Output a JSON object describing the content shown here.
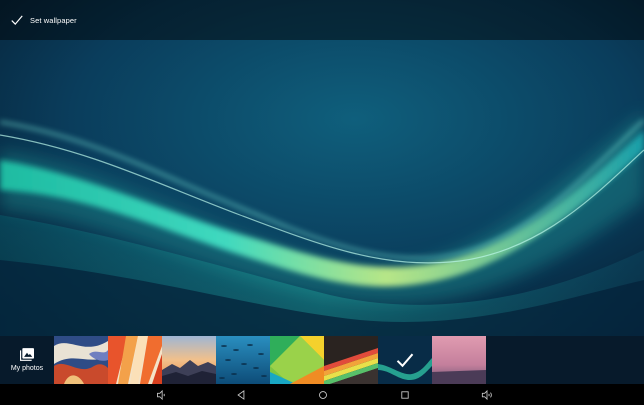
{
  "action_bar": {
    "set_wallpaper_label": "Set wallpaper",
    "icon": "check-icon"
  },
  "strip": {
    "my_photos_label": "My photos",
    "my_photos_icon": "photo-gallery-icon",
    "thumbnails": [
      {
        "name": "wallpaper-thumb-marble"
      },
      {
        "name": "wallpaper-thumb-orange-layers"
      },
      {
        "name": "wallpaper-thumb-sunset-mountains"
      },
      {
        "name": "wallpaper-thumb-fish-school"
      },
      {
        "name": "wallpaper-thumb-green-yellow"
      },
      {
        "name": "wallpaper-thumb-rainbow-stripes"
      },
      {
        "name": "wallpaper-thumb-aqua-wave",
        "selected": true
      },
      {
        "name": "wallpaper-thumb-pink-horizon"
      }
    ]
  },
  "nav_bar": {
    "buttons": [
      "volume-down-icon",
      "back-icon",
      "home-icon",
      "recents-icon",
      "volume-up-icon"
    ]
  },
  "colors": {
    "wallpaper_dark": "#0a2a45",
    "wallpaper_glow": "#35e0c0",
    "nav_bg": "#000000",
    "strip_bg": "#071a2b"
  }
}
